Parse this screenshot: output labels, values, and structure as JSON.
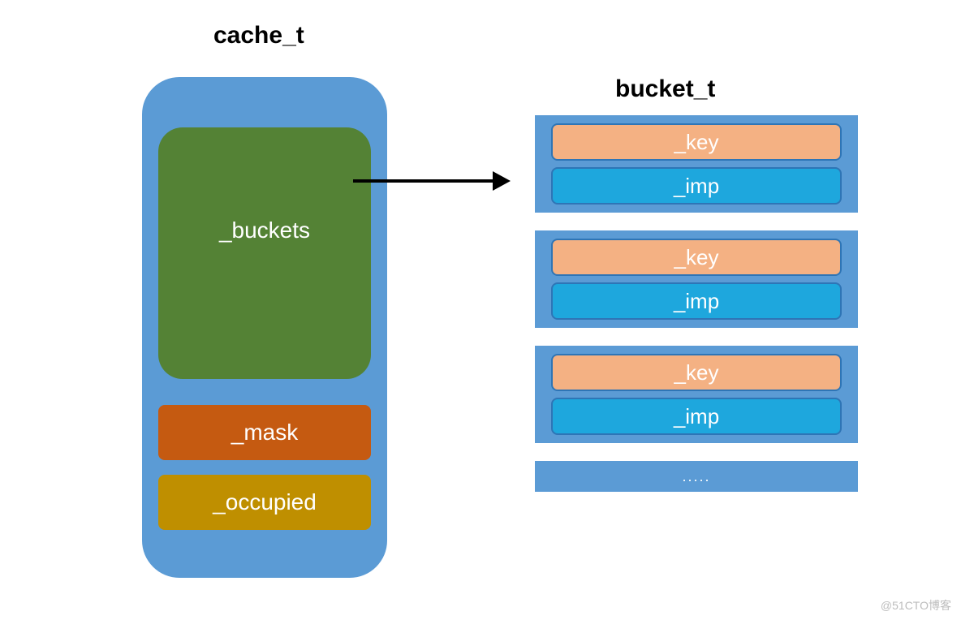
{
  "titles": {
    "cache": "cache_t",
    "bucket": "bucket_t"
  },
  "cache": {
    "buckets_label": "_buckets",
    "mask_label": "_mask",
    "occupied_label": "_occupied"
  },
  "bucket_entries": [
    {
      "key": "_key",
      "imp": "_imp"
    },
    {
      "key": "_key",
      "imp": "_imp"
    },
    {
      "key": "_key",
      "imp": "_imp"
    }
  ],
  "ellipsis": ".....",
  "watermark": "@51CTO博客",
  "colors": {
    "container_blue": "#5b9bd5",
    "buckets_green": "#548235",
    "mask_orange": "#c55a11",
    "occupied_gold": "#bf8f00",
    "key_peach": "#f4b183",
    "imp_cyan": "#1ea7dd",
    "row_border": "#2e75b6"
  }
}
